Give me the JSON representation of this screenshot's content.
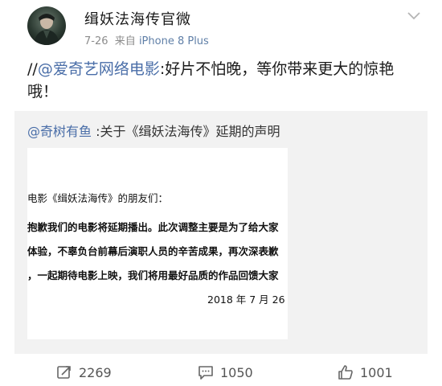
{
  "post": {
    "author": "缉妖法海传官微",
    "date": "7-26",
    "source_prefix": "来自",
    "source_device": "iPhone 8 Plus",
    "text_prefix": "//",
    "mention": "@爱奇艺网络电影",
    "text_line1": ":好片不怕晚，等你带来更大的惊艳",
    "text_line2": "哦！"
  },
  "repost": {
    "mention": "@奇树有鱼",
    "text": " :关于《缉妖法海传》延期的声明",
    "doc_lines": [
      "电影《缉妖法海传》的朋友们：",
      "抱歉我们的电影将延期播出。此次调整主要是为了给大家",
      "体验，不辜负台前幕后演职人员的辛苦成果，再次深表歉",
      "，一起期待电影上映，我们将用最好品质的作品回馈大家",
      "2018 年 7 月 26 日"
    ]
  },
  "actions": {
    "repost_count": "2269",
    "comment_count": "1050",
    "like_count": "1001"
  },
  "icons": [
    "avatar",
    "chevron-down-icon",
    "repost-icon",
    "comment-icon",
    "like-icon"
  ],
  "colors": {
    "mention": "#4a6ea8",
    "meta": "#8c8c8c",
    "repost_bg": "#f2f2f2"
  }
}
